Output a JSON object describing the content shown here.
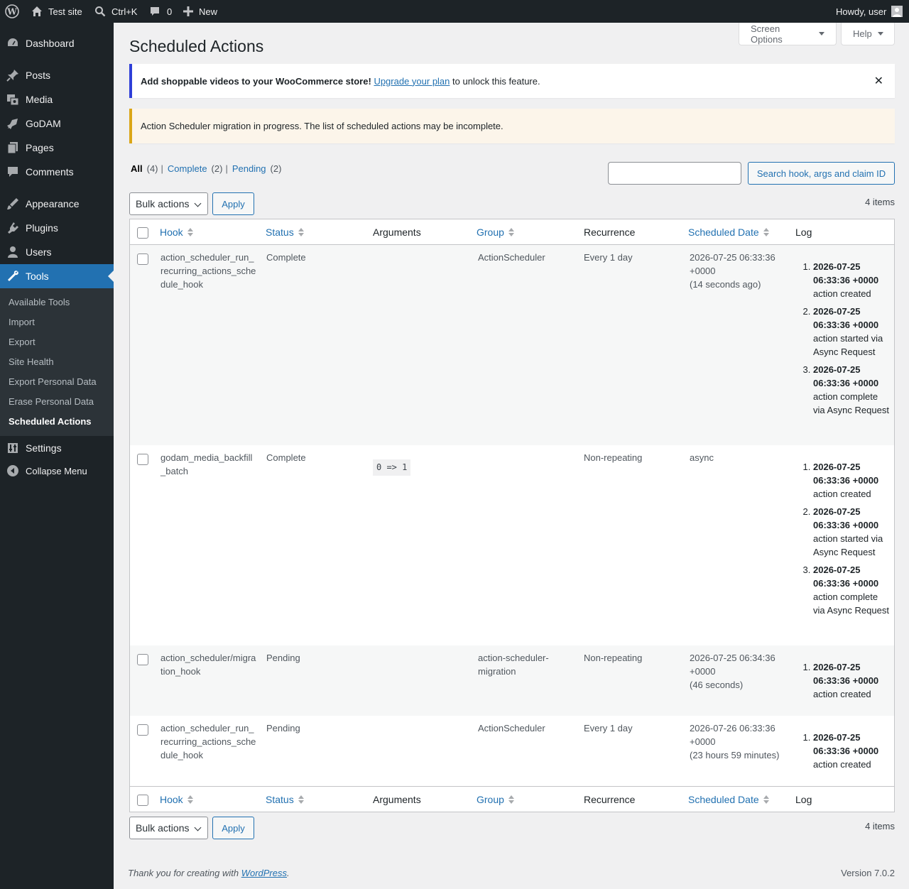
{
  "adminbar": {
    "site_name": "Test site",
    "shortcut": "Ctrl+K",
    "comments_count": "0",
    "new_label": "New",
    "howdy": "Howdy, user"
  },
  "sidebar": {
    "items": [
      {
        "label": "Dashboard",
        "icon": "dashboard-icon"
      },
      {
        "label": "Posts",
        "icon": "pin-icon"
      },
      {
        "label": "Media",
        "icon": "media-icon"
      },
      {
        "label": "GoDAM",
        "icon": "godam-icon"
      },
      {
        "label": "Pages",
        "icon": "pages-icon"
      },
      {
        "label": "Comments",
        "icon": "comments-icon"
      },
      {
        "label": "Appearance",
        "icon": "appearance-icon"
      },
      {
        "label": "Plugins",
        "icon": "plugins-icon"
      },
      {
        "label": "Users",
        "icon": "users-icon"
      },
      {
        "label": "Tools",
        "icon": "tools-icon"
      },
      {
        "label": "Settings",
        "icon": "settings-icon"
      },
      {
        "label": "Collapse Menu",
        "icon": "collapse-icon"
      }
    ],
    "submenu": [
      "Available Tools",
      "Import",
      "Export",
      "Site Health",
      "Export Personal Data",
      "Erase Personal Data",
      "Scheduled Actions"
    ]
  },
  "header": {
    "screen_options": "Screen Options",
    "help": "Help",
    "title": "Scheduled Actions"
  },
  "notices": {
    "promo_bold": "Add shoppable videos to your WooCommerce store!",
    "promo_link": "Upgrade your plan",
    "promo_rest": "to unlock this feature.",
    "dismiss": "✕",
    "migration": "Action Scheduler migration in progress. The list of scheduled actions may be incomplete."
  },
  "filters": {
    "all": "All",
    "all_count": "(4)",
    "complete": "Complete",
    "complete_count": "(2)",
    "pending": "Pending",
    "pending_count": "(2)",
    "sep": "|"
  },
  "search": {
    "placeholder": "",
    "button": "Search hook, args and claim ID"
  },
  "tablenav": {
    "bulk": "Bulk actions",
    "apply": "Apply",
    "count": "4 items"
  },
  "columns": {
    "hook": "Hook",
    "status": "Status",
    "arguments": "Arguments",
    "group": "Group",
    "recurrence": "Recurrence",
    "scheduled": "Scheduled Date",
    "log": "Log"
  },
  "rows": [
    {
      "hook": "action_scheduler_run_recurring_actions_schedule_hook",
      "status": "Complete",
      "args": "",
      "group": "ActionScheduler",
      "recurrence": "Every 1 day",
      "date1": "2026-07-25 06:33:36",
      "date2": "+0000",
      "date3": "(14 seconds ago)",
      "log": [
        {
          "time": "2026-07-25 06:33:36 +0000",
          "msg": "action created"
        },
        {
          "time": "2026-07-25 06:33:36 +0000",
          "msg": "action started via Async Request"
        },
        {
          "time": "2026-07-25 06:33:36 +0000",
          "msg": "action complete via Async Request"
        }
      ]
    },
    {
      "hook": "godam_media_backfill_batch",
      "status": "Complete",
      "args": "0 => 1",
      "group": "",
      "recurrence": "Non-repeating",
      "date1": "async",
      "date2": "",
      "date3": "",
      "log": [
        {
          "time": "2026-07-25 06:33:36 +0000",
          "msg": "action created"
        },
        {
          "time": "2026-07-25 06:33:36 +0000",
          "msg": "action started via Async Request"
        },
        {
          "time": "2026-07-25 06:33:36 +0000",
          "msg": "action complete via Async Request"
        }
      ]
    },
    {
      "hook": "action_scheduler/migration_hook",
      "status": "Pending",
      "args": "",
      "group": "action-scheduler-migration",
      "recurrence": "Non-repeating",
      "date1": "2026-07-25 06:34:36",
      "date2": "+0000",
      "date3": "(46 seconds)",
      "log": [
        {
          "time": "2026-07-25 06:33:36 +0000",
          "msg": "action created"
        }
      ]
    },
    {
      "hook": "action_scheduler_run_recurring_actions_schedule_hook",
      "status": "Pending",
      "args": "",
      "group": "ActionScheduler",
      "recurrence": "Every 1 day",
      "date1": "2026-07-26 06:33:36",
      "date2": "+0000",
      "date3": "(23 hours 59 minutes)",
      "log": [
        {
          "time": "2026-07-25 06:33:36 +0000",
          "msg": "action created"
        }
      ]
    }
  ],
  "footer": {
    "thanks": "Thank you for creating with",
    "link": "WordPress",
    "dot": ".",
    "version": "Version 7.0.2"
  }
}
